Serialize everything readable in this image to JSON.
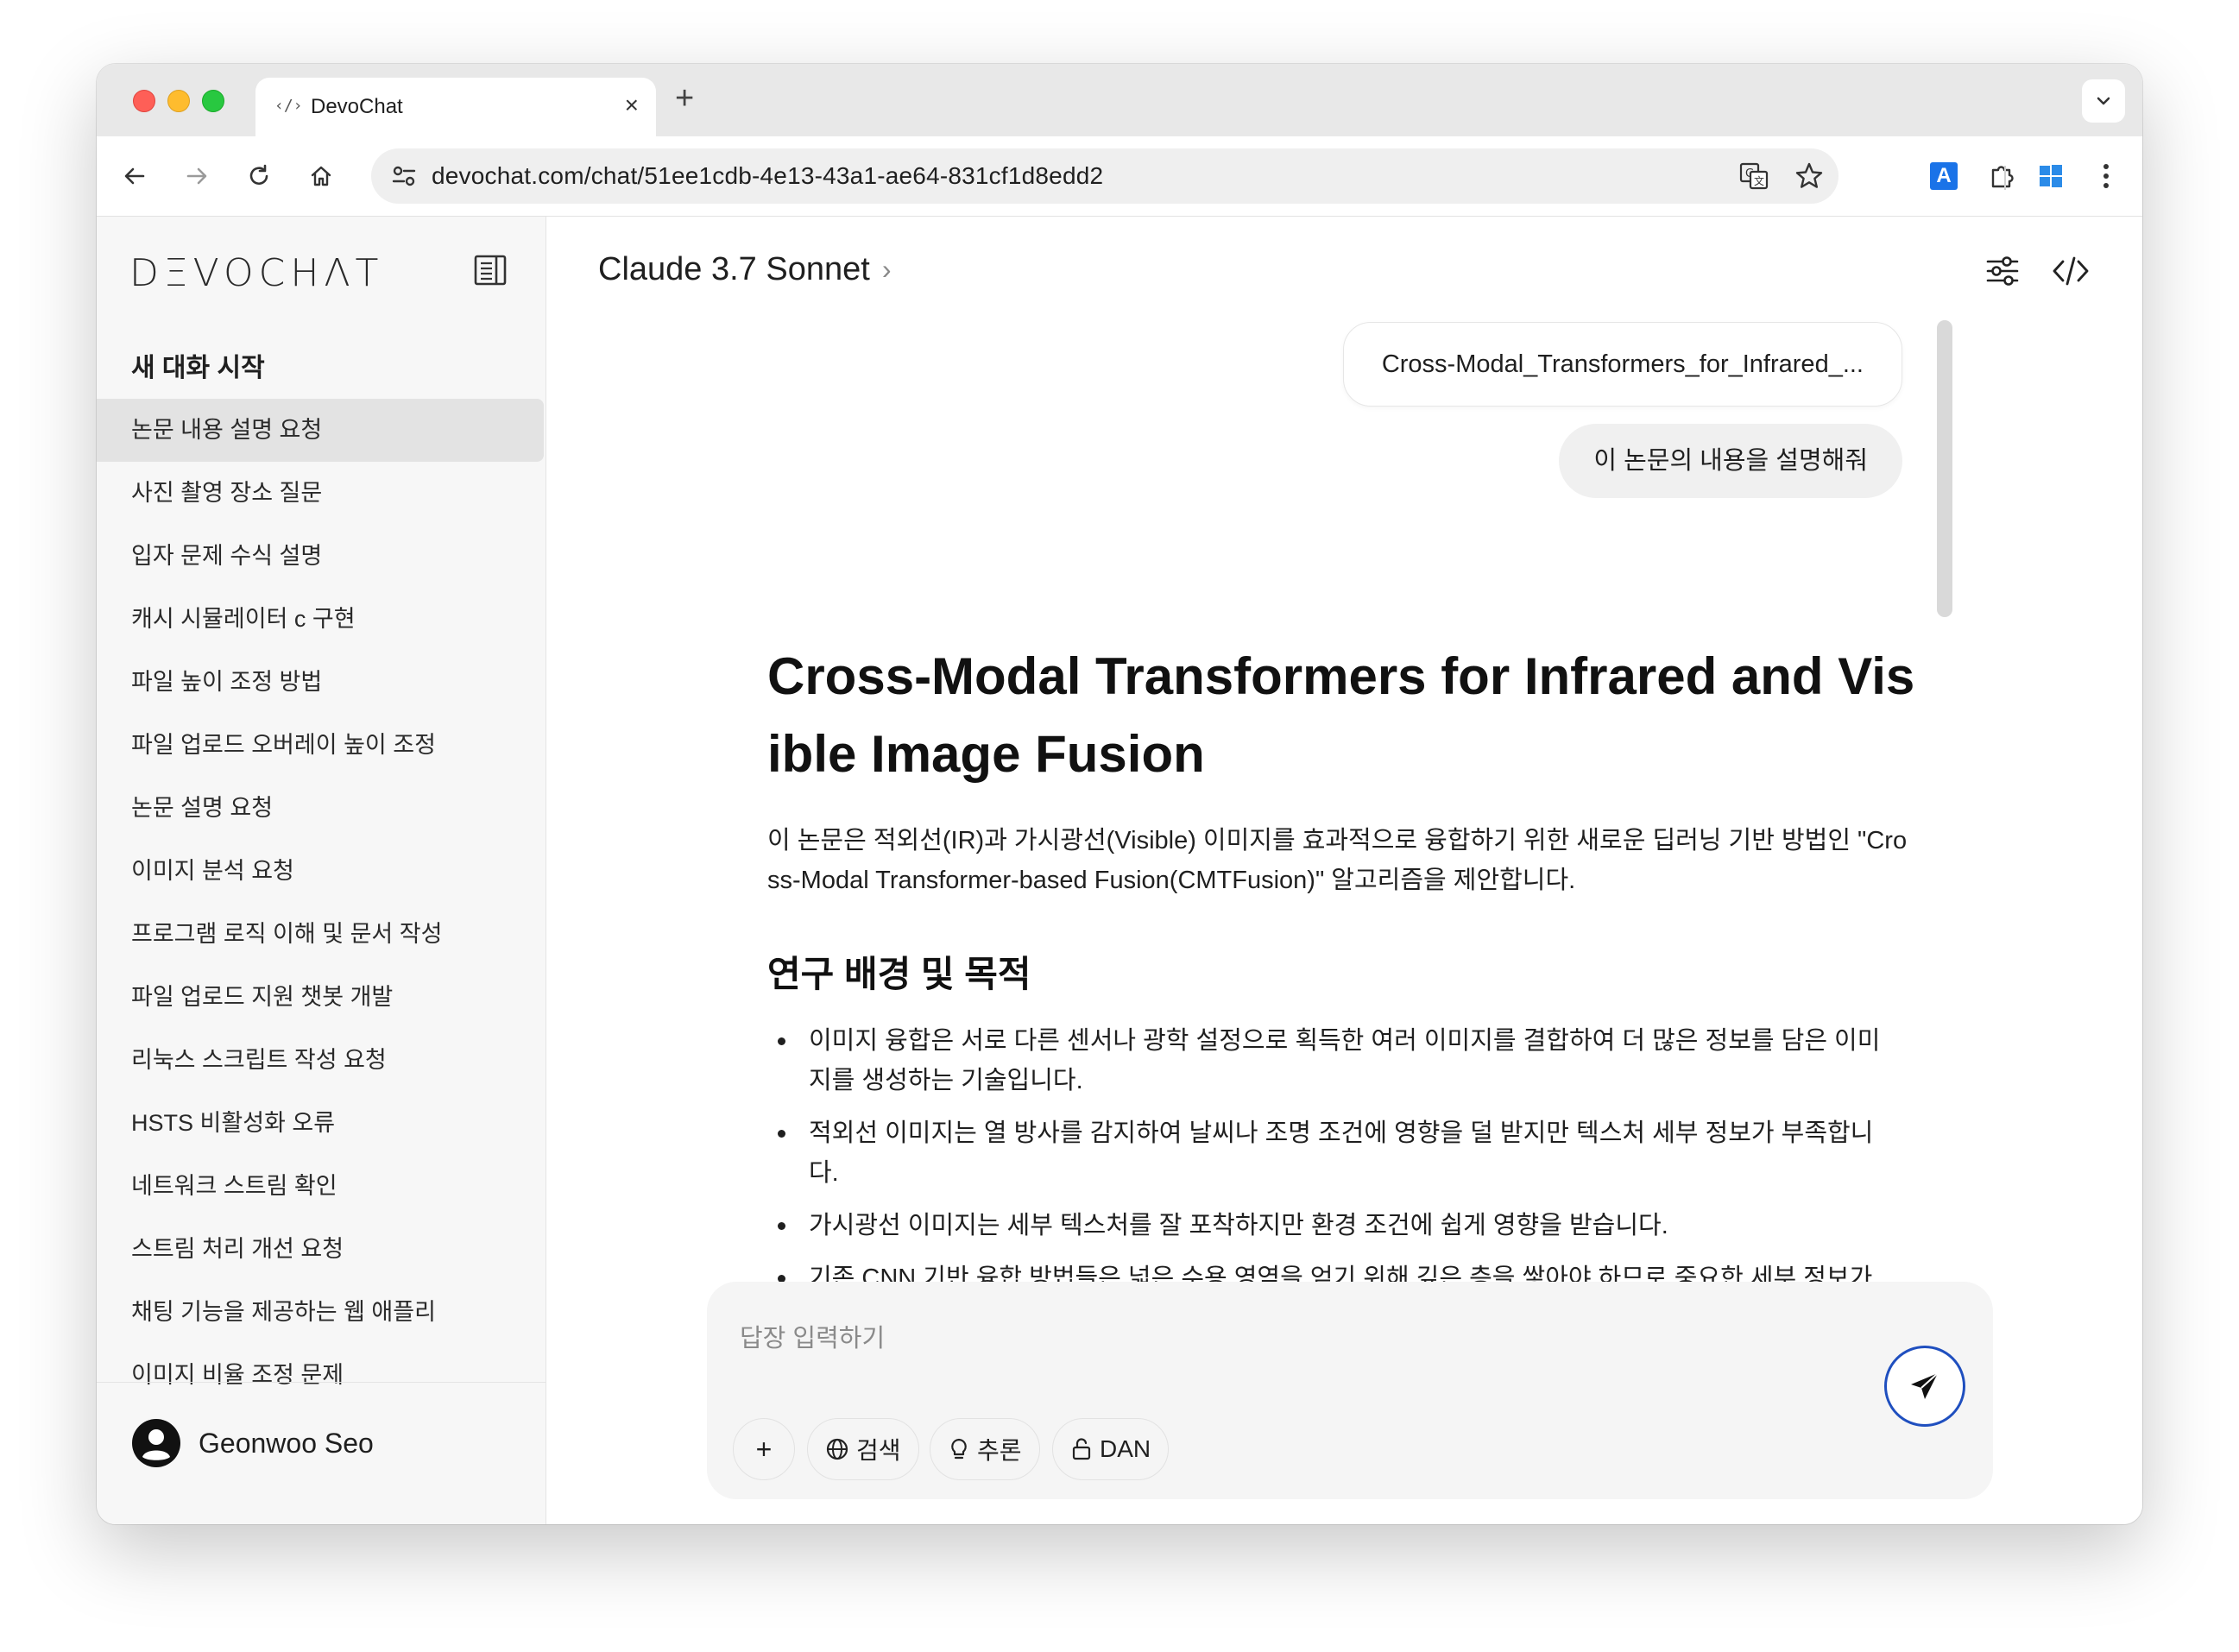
{
  "browser": {
    "tab_title": "DevoChat",
    "tab_favicon": "‹/›",
    "url": "devochat.com/chat/51ee1cdb-4e13-43a1-ae64-831cf1d8edd2"
  },
  "sidebar": {
    "logo": "DΞVOCHΛT",
    "new_chat": "새 대화 시작",
    "items": [
      {
        "label": "논문 내용 설명 요청",
        "active": true
      },
      {
        "label": "사진 촬영 장소 질문"
      },
      {
        "label": "입자 문제 수식 설명"
      },
      {
        "label": "캐시 시뮬레이터 c 구현"
      },
      {
        "label": "파일 높이 조정 방법"
      },
      {
        "label": "파일 업로드 오버레이 높이 조정"
      },
      {
        "label": "논문 설명 요청"
      },
      {
        "label": "이미지 분석 요청"
      },
      {
        "label": "프로그램 로직 이해 및 문서 작성"
      },
      {
        "label": "파일 업로드 지원 챗봇 개발"
      },
      {
        "label": "리눅스 스크립트 작성 요청"
      },
      {
        "label": "HSTS 비활성화 오류"
      },
      {
        "label": "네트워크 스트림 확인"
      },
      {
        "label": "스트림 처리 개선 요청"
      },
      {
        "label": "채팅 기능을 제공하는 웹 애플리"
      },
      {
        "label": "이미지 비율 조정 문제"
      }
    ],
    "user_name": "Geonwoo Seo"
  },
  "main": {
    "model_name": "Claude 3.7 Sonnet",
    "file_bubble": "Cross-Modal_Transformers_for_Infrared_...",
    "user_message": "이 논문의 내용을 설명해줘",
    "response": {
      "title": "Cross-Modal Transformers for Infrared and Visible Image Fusion",
      "intro": "이 논문은 적외선(IR)과 가시광선(Visible) 이미지를 효과적으로 융합하기 위한 새로운 딥러닝 기반 방법인 \"Cross-Modal Transformer-based Fusion(CMTFusion)\" 알고리즘을 제안합니다.",
      "section_heading": "연구 배경 및 목적",
      "bullets": [
        "이미지 융합은 서로 다른 센서나 광학 설정으로 획득한 여러 이미지를 결합하여 더 많은 정보를 담은 이미지를 생성하는 기술입니다.",
        "적외선 이미지는 열 방사를 감지하여 날씨나 조명 조건에 영향을 덜 받지만 텍스처 세부 정보가 부족합니다.",
        "가시광선 이미지는 세부 텍스처를 잘 포착하지만 환경 조건에 쉽게 영향을 받습니다.",
        "기존 CNN 기반 융합 방법들은 넓은 수용 영역을 얻기 위해 깊은 층을 쌓아야 하므로 중요한 세부 정보가 손실될 수 있습니다."
      ]
    },
    "composer": {
      "placeholder": "답장 입력하기",
      "add_label": "+",
      "search_label": "검색",
      "reason_label": "추론",
      "dan_label": "DAN"
    }
  },
  "colors": {
    "accent": "#1f4fbf",
    "sidebar_bg": "#f7f7f7",
    "active_item_bg": "#e3e3e3",
    "bubble_bg": "#f0f0f0"
  }
}
